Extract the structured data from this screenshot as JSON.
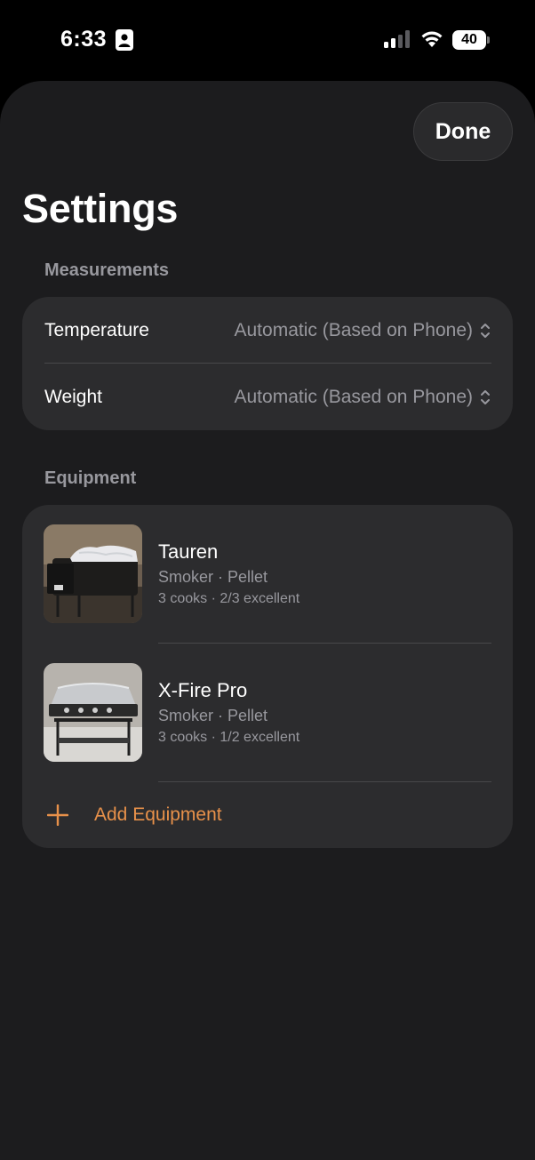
{
  "status_bar": {
    "time": "6:33",
    "battery": "40"
  },
  "header": {
    "done_label": "Done",
    "title": "Settings"
  },
  "measurements": {
    "section_label": "Measurements",
    "rows": [
      {
        "label": "Temperature",
        "value": "Automatic (Based on Phone)"
      },
      {
        "label": "Weight",
        "value": "Automatic (Based on Phone)"
      }
    ]
  },
  "equipment": {
    "section_label": "Equipment",
    "items": [
      {
        "name": "Tauren",
        "type": "Smoker · Pellet",
        "stats": "3 cooks · 2/3 excellent"
      },
      {
        "name": "X-Fire Pro",
        "type": "Smoker · Pellet",
        "stats": "3 cooks · 1/2 excellent"
      }
    ],
    "add_label": "Add Equipment"
  },
  "colors": {
    "accent": "#e8914a",
    "background": "#1c1c1e",
    "card": "#2c2c2e",
    "secondary_text": "#98989e"
  },
  "icons": [
    "person-id-icon",
    "signal-icon",
    "wifi-icon",
    "battery-icon",
    "chevron-updown-icon",
    "plus-icon"
  ]
}
